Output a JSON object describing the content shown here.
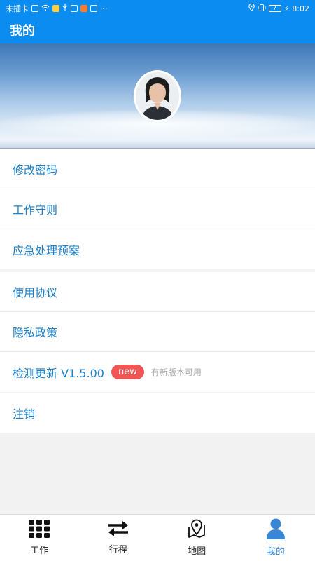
{
  "statusbar": {
    "carrier": "未插卡",
    "time": "8:02",
    "battery": "7"
  },
  "header": {
    "title": "我的"
  },
  "profile": {
    "avatar_alt": "avatar"
  },
  "menu_group1": [
    {
      "label": "修改密码"
    },
    {
      "label": "工作守则"
    },
    {
      "label": "应急处理预案"
    }
  ],
  "menu_group2": [
    {
      "label": "使用协议"
    },
    {
      "label": "隐私政策"
    },
    {
      "label": "检测更新 V1.5.00",
      "badge": "new",
      "hint": "有新版本可用"
    }
  ],
  "menu_group3": [
    {
      "label": "注销"
    }
  ],
  "tabbar": [
    {
      "label": "工作",
      "icon": "grid-icon"
    },
    {
      "label": "行程",
      "icon": "swap-arrows-icon"
    },
    {
      "label": "地图",
      "icon": "map-pin-icon"
    },
    {
      "label": "我的",
      "icon": "person-icon",
      "active": true
    }
  ],
  "colors": {
    "primary": "#0a8cf0",
    "link": "#1a7fc9",
    "badge": "#f05656",
    "active_tab": "#3a86d6"
  }
}
